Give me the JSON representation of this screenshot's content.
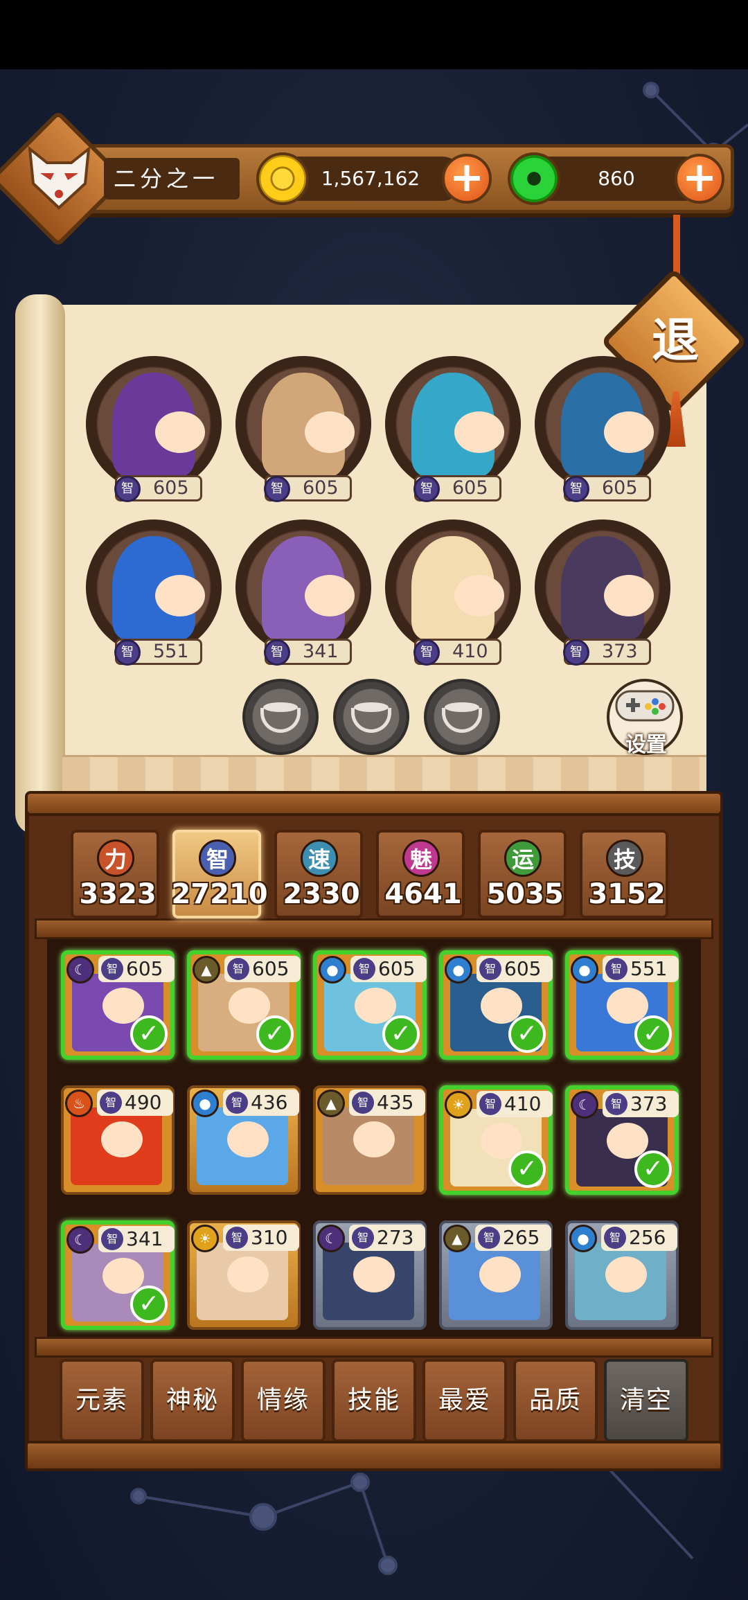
{
  "player": {
    "name": "二分之一"
  },
  "currency": {
    "coins": "1,567,162",
    "gems": "860"
  },
  "retreat_label": "退",
  "settings_label": "设置",
  "team": [
    {
      "value": "605",
      "stat": "智"
    },
    {
      "value": "605",
      "stat": "智"
    },
    {
      "value": "605",
      "stat": "智"
    },
    {
      "value": "605",
      "stat": "智"
    },
    {
      "value": "551",
      "stat": "智"
    },
    {
      "value": "341",
      "stat": "智"
    },
    {
      "value": "410",
      "stat": "智"
    },
    {
      "value": "373",
      "stat": "智"
    }
  ],
  "stats": [
    {
      "label": "力",
      "value": "3323",
      "color": "#c8522a"
    },
    {
      "label": "智",
      "value": "27210",
      "color": "#4b5fb0"
    },
    {
      "label": "速",
      "value": "2330",
      "color": "#3c8fb0"
    },
    {
      "label": "魅",
      "value": "4641",
      "color": "#c0388f"
    },
    {
      "label": "运",
      "value": "5035",
      "color": "#3f9a3a"
    },
    {
      "label": "技",
      "value": "3152",
      "color": "#5a5a5a"
    }
  ],
  "roster": [
    {
      "value": "605",
      "stat": "智",
      "element": "moon",
      "selected": true
    },
    {
      "value": "605",
      "stat": "智",
      "element": "earth",
      "selected": true
    },
    {
      "value": "605",
      "stat": "智",
      "element": "water",
      "selected": true
    },
    {
      "value": "605",
      "stat": "智",
      "element": "water",
      "selected": true
    },
    {
      "value": "551",
      "stat": "智",
      "element": "water",
      "selected": true
    },
    {
      "value": "490",
      "stat": "智",
      "element": "fire",
      "selected": false
    },
    {
      "value": "436",
      "stat": "智",
      "element": "water",
      "selected": false
    },
    {
      "value": "435",
      "stat": "智",
      "element": "earth",
      "selected": false
    },
    {
      "value": "410",
      "stat": "智",
      "element": "sun",
      "selected": true
    },
    {
      "value": "373",
      "stat": "智",
      "element": "moon",
      "selected": true
    },
    {
      "value": "341",
      "stat": "智",
      "element": "moon",
      "selected": true
    },
    {
      "value": "310",
      "stat": "智",
      "element": "sun",
      "selected": false
    },
    {
      "value": "273",
      "stat": "智",
      "element": "moon",
      "selected": false
    },
    {
      "value": "265",
      "stat": "智",
      "element": "earth",
      "selected": false
    },
    {
      "value": "256",
      "stat": "智",
      "element": "water",
      "selected": false
    }
  ],
  "filters": [
    {
      "label": "元素"
    },
    {
      "label": "神秘"
    },
    {
      "label": "情缘"
    },
    {
      "label": "技能"
    },
    {
      "label": "最爱"
    },
    {
      "label": "品质"
    },
    {
      "label": "清空"
    }
  ]
}
